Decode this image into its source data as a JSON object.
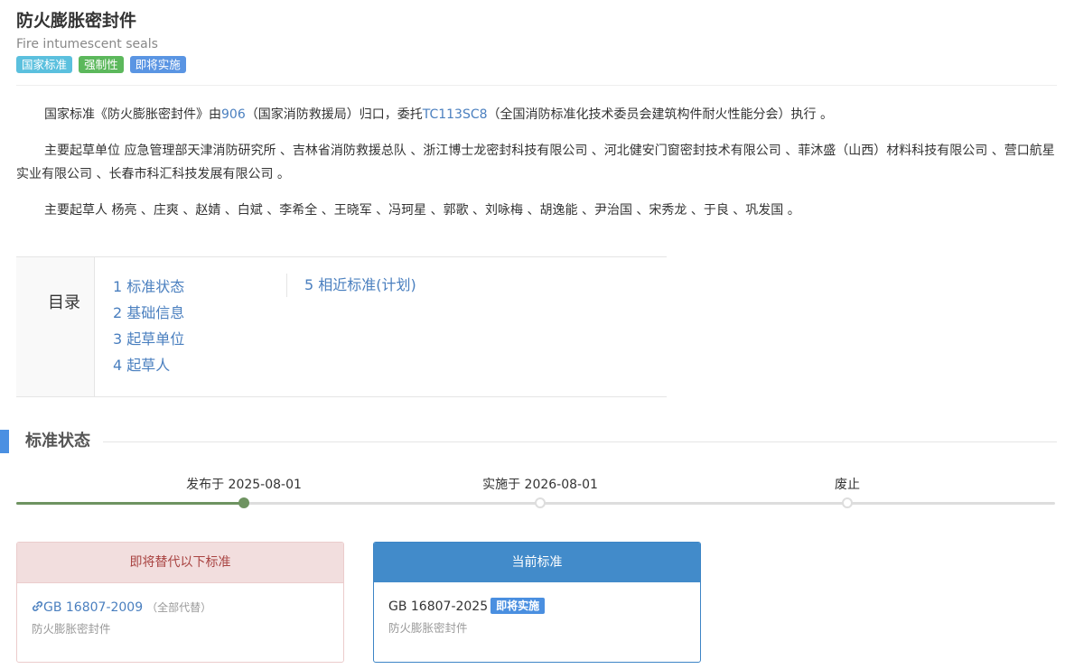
{
  "header": {
    "title": "防火膨胀密封件",
    "subtitle": "Fire intumescent seals",
    "badges": [
      "国家标准",
      "强制性",
      "即将实施"
    ]
  },
  "intro": {
    "p1_before": "国家标准《防火膨胀密封件》由",
    "p1_link1": "906",
    "p1_mid": "（国家消防救援局）归口，委托",
    "p1_link2": "TC113SC8",
    "p1_after": "（全国消防标准化技术委员会建筑构件耐火性能分会）执行 。",
    "p2": "主要起草单位 应急管理部天津消防研究所 、吉林省消防救援总队 、浙江博士龙密封科技有限公司 、河北健安门窗密封技术有限公司 、菲沐盛（山西）材料科技有限公司 、营口航星实业有限公司 、长春市科汇科技发展有限公司 。",
    "p3": "主要起草人 杨亮 、庄爽 、赵婧 、白斌 、李希全 、王晓军 、冯珂星 、郭歌 、刘咏梅 、胡逸能 、尹治国 、宋秀龙 、于良 、巩发国 。"
  },
  "toc": {
    "label": "目录",
    "items": [
      "1  标准状态",
      "2  基础信息",
      "3  起草单位",
      "4  起草人",
      "5  相近标准(计划)"
    ]
  },
  "status": {
    "section_title": "标准状态",
    "milestones": [
      {
        "label": "发布于 2025-08-01",
        "done": true
      },
      {
        "label": "实施于 2026-08-01",
        "done": false
      },
      {
        "label": "废止",
        "done": false
      }
    ],
    "progress_fraction": 0.22
  },
  "replace_card": {
    "header": "即将替代以下标准",
    "code": "GB 16807-2009",
    "note": "（全部代替）",
    "name": "防火膨胀密封件",
    "icon": "link-icon"
  },
  "current_card": {
    "header": "当前标准",
    "code": "GB 16807-2025",
    "badge": "即将实施",
    "name": "防火膨胀密封件"
  },
  "colors": {
    "accent": "#428bca",
    "link": "#4a7fbf",
    "progress": "#6e9361",
    "danger_bg": "#f2dede",
    "danger_text": "#a94442"
  }
}
